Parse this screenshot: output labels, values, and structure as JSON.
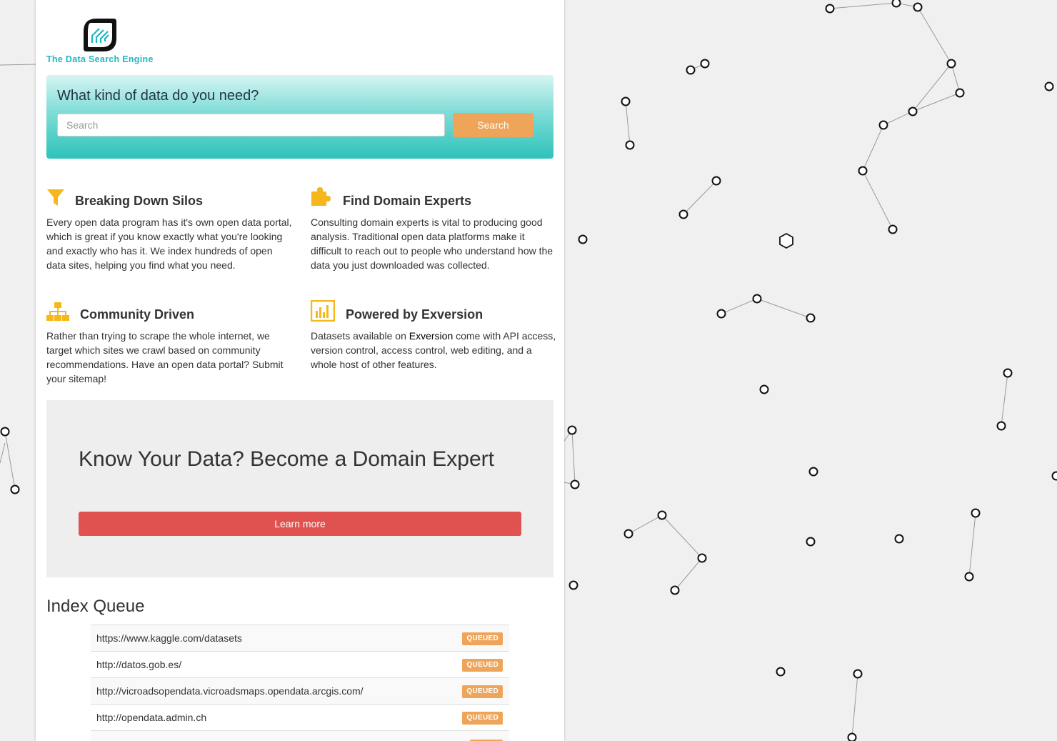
{
  "brand": {
    "name": "The Data Search Engine",
    "accent_color": "#1fb8c2"
  },
  "search": {
    "heading": "What kind of data do you need?",
    "placeholder": "Search",
    "button_label": "Search",
    "button_color": "#eea55a"
  },
  "features": [
    {
      "icon": "funnel-icon",
      "title": "Breaking Down Silos",
      "text": "Every open data program has it's own open data portal, which is great if you know exactly what you're looking and exactly who has it. We index hundreds of open data sites, helping you find what you need."
    },
    {
      "icon": "puzzle-icon",
      "title": "Find Domain Experts",
      "text": "Consulting domain experts is vital to producing good analysis. Traditional open data platforms make it difficult to reach out to people who understand how the data you just downloaded was collected."
    },
    {
      "icon": "sitemap-icon",
      "title": "Community Driven",
      "text": "Rather than trying to scrape the whole internet, we target which sites we crawl based on community recommendations. Have an open data portal? Submit your sitemap!"
    },
    {
      "icon": "bar-chart-icon",
      "title": "Powered by Exversion",
      "text_before": "Datasets available on ",
      "link": "Exversion",
      "text_after": " come with API access, version control, access control, web editing, and a whole host of other features."
    }
  ],
  "promo": {
    "title": "Know Your Data? Become a Domain Expert",
    "button_label": "Learn more",
    "button_color": "#e0524f"
  },
  "queue": {
    "title": "Index Queue",
    "rows": [
      {
        "url": "https://www.kaggle.com/datasets",
        "status": "QUEUED"
      },
      {
        "url": "http://datos.gob.es/",
        "status": "QUEUED"
      },
      {
        "url": "http://vicroadsopendata.vicroadsmaps.opendata.arcgis.com/",
        "status": "QUEUED"
      },
      {
        "url": "http://opendata.admin.ch",
        "status": "QUEUED"
      },
      {
        "url": "",
        "status": ""
      }
    ]
  }
}
